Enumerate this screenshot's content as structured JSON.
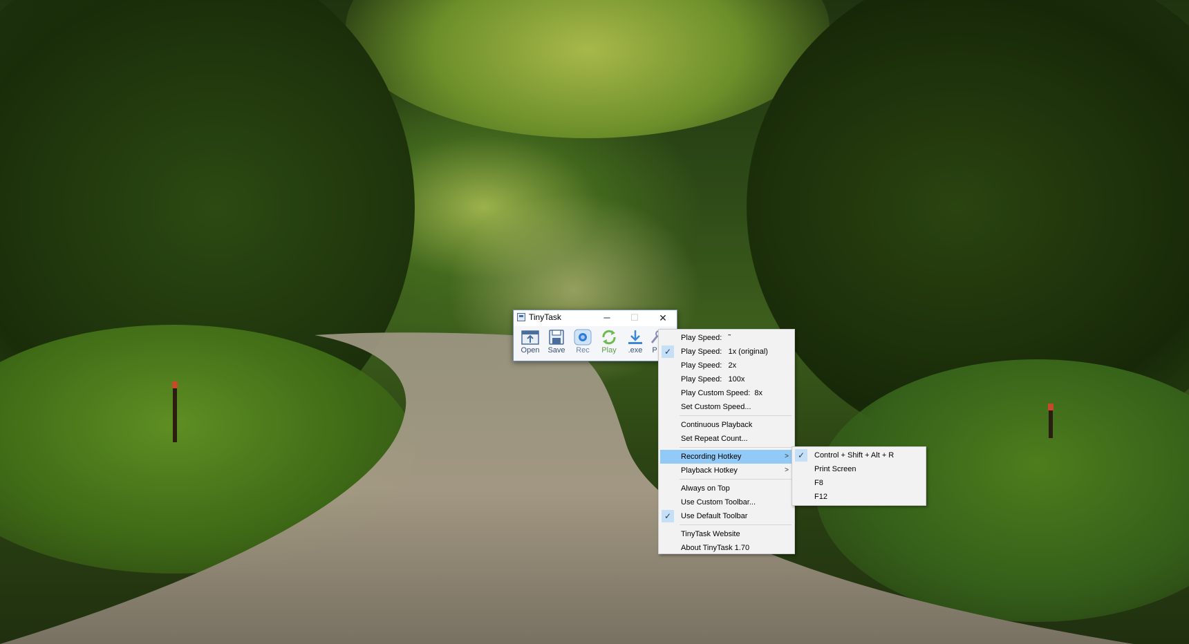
{
  "window": {
    "title": "TinyTask",
    "controls": {
      "minimize": "─",
      "maximize": "☐",
      "close": "✕"
    },
    "toolbar": [
      {
        "id": "open",
        "label": "Open"
      },
      {
        "id": "save",
        "label": "Save"
      },
      {
        "id": "rec",
        "label": "Rec"
      },
      {
        "id": "play",
        "label": "Play"
      },
      {
        "id": "exe",
        "label": ".exe"
      },
      {
        "id": "prefs",
        "label": "P"
      }
    ]
  },
  "menu": {
    "items": [
      {
        "label": "Play Speed:   ˜",
        "checked": false
      },
      {
        "label": "Play Speed:   1x (original)",
        "checked": true
      },
      {
        "label": "Play Speed:   2x",
        "checked": false
      },
      {
        "label": "Play Speed:   100x",
        "checked": false
      },
      {
        "label": "Play Custom Speed:  8x",
        "checked": false
      },
      {
        "label": "Set Custom Speed...",
        "checked": false
      },
      {
        "label": "Continuous Playback",
        "checked": false
      },
      {
        "label": "Set Repeat Count...",
        "checked": false
      },
      {
        "label": "Recording Hotkey",
        "submenu": true,
        "highlighted": true
      },
      {
        "label": "Playback Hotkey",
        "submenu": true
      },
      {
        "label": "Always on Top",
        "checked": false
      },
      {
        "label": "Use Custom Toolbar...",
        "checked": false
      },
      {
        "label": "Use Default Toolbar",
        "checked": true
      },
      {
        "label": "TinyTask Website",
        "checked": false
      },
      {
        "label": "About TinyTask 1.70",
        "checked": false
      }
    ],
    "check_glyph": "✓",
    "arrow_glyph": ">"
  },
  "submenu": {
    "items": [
      {
        "label": "Control + Shift + Alt + R",
        "checked": true
      },
      {
        "label": "Print Screen",
        "checked": false
      },
      {
        "label": "F8",
        "checked": false
      },
      {
        "label": "F12",
        "checked": false
      }
    ]
  },
  "colors": {
    "menu_bg": "#f2f2f2",
    "highlight": "#91c9f7",
    "check_bg": "#c5dff7"
  },
  "icons": {
    "open": "folder-open-icon",
    "save": "floppy-disk-icon",
    "rec": "record-icon",
    "play": "play-repeat-icon",
    "exe": "download-arrow-icon"
  }
}
